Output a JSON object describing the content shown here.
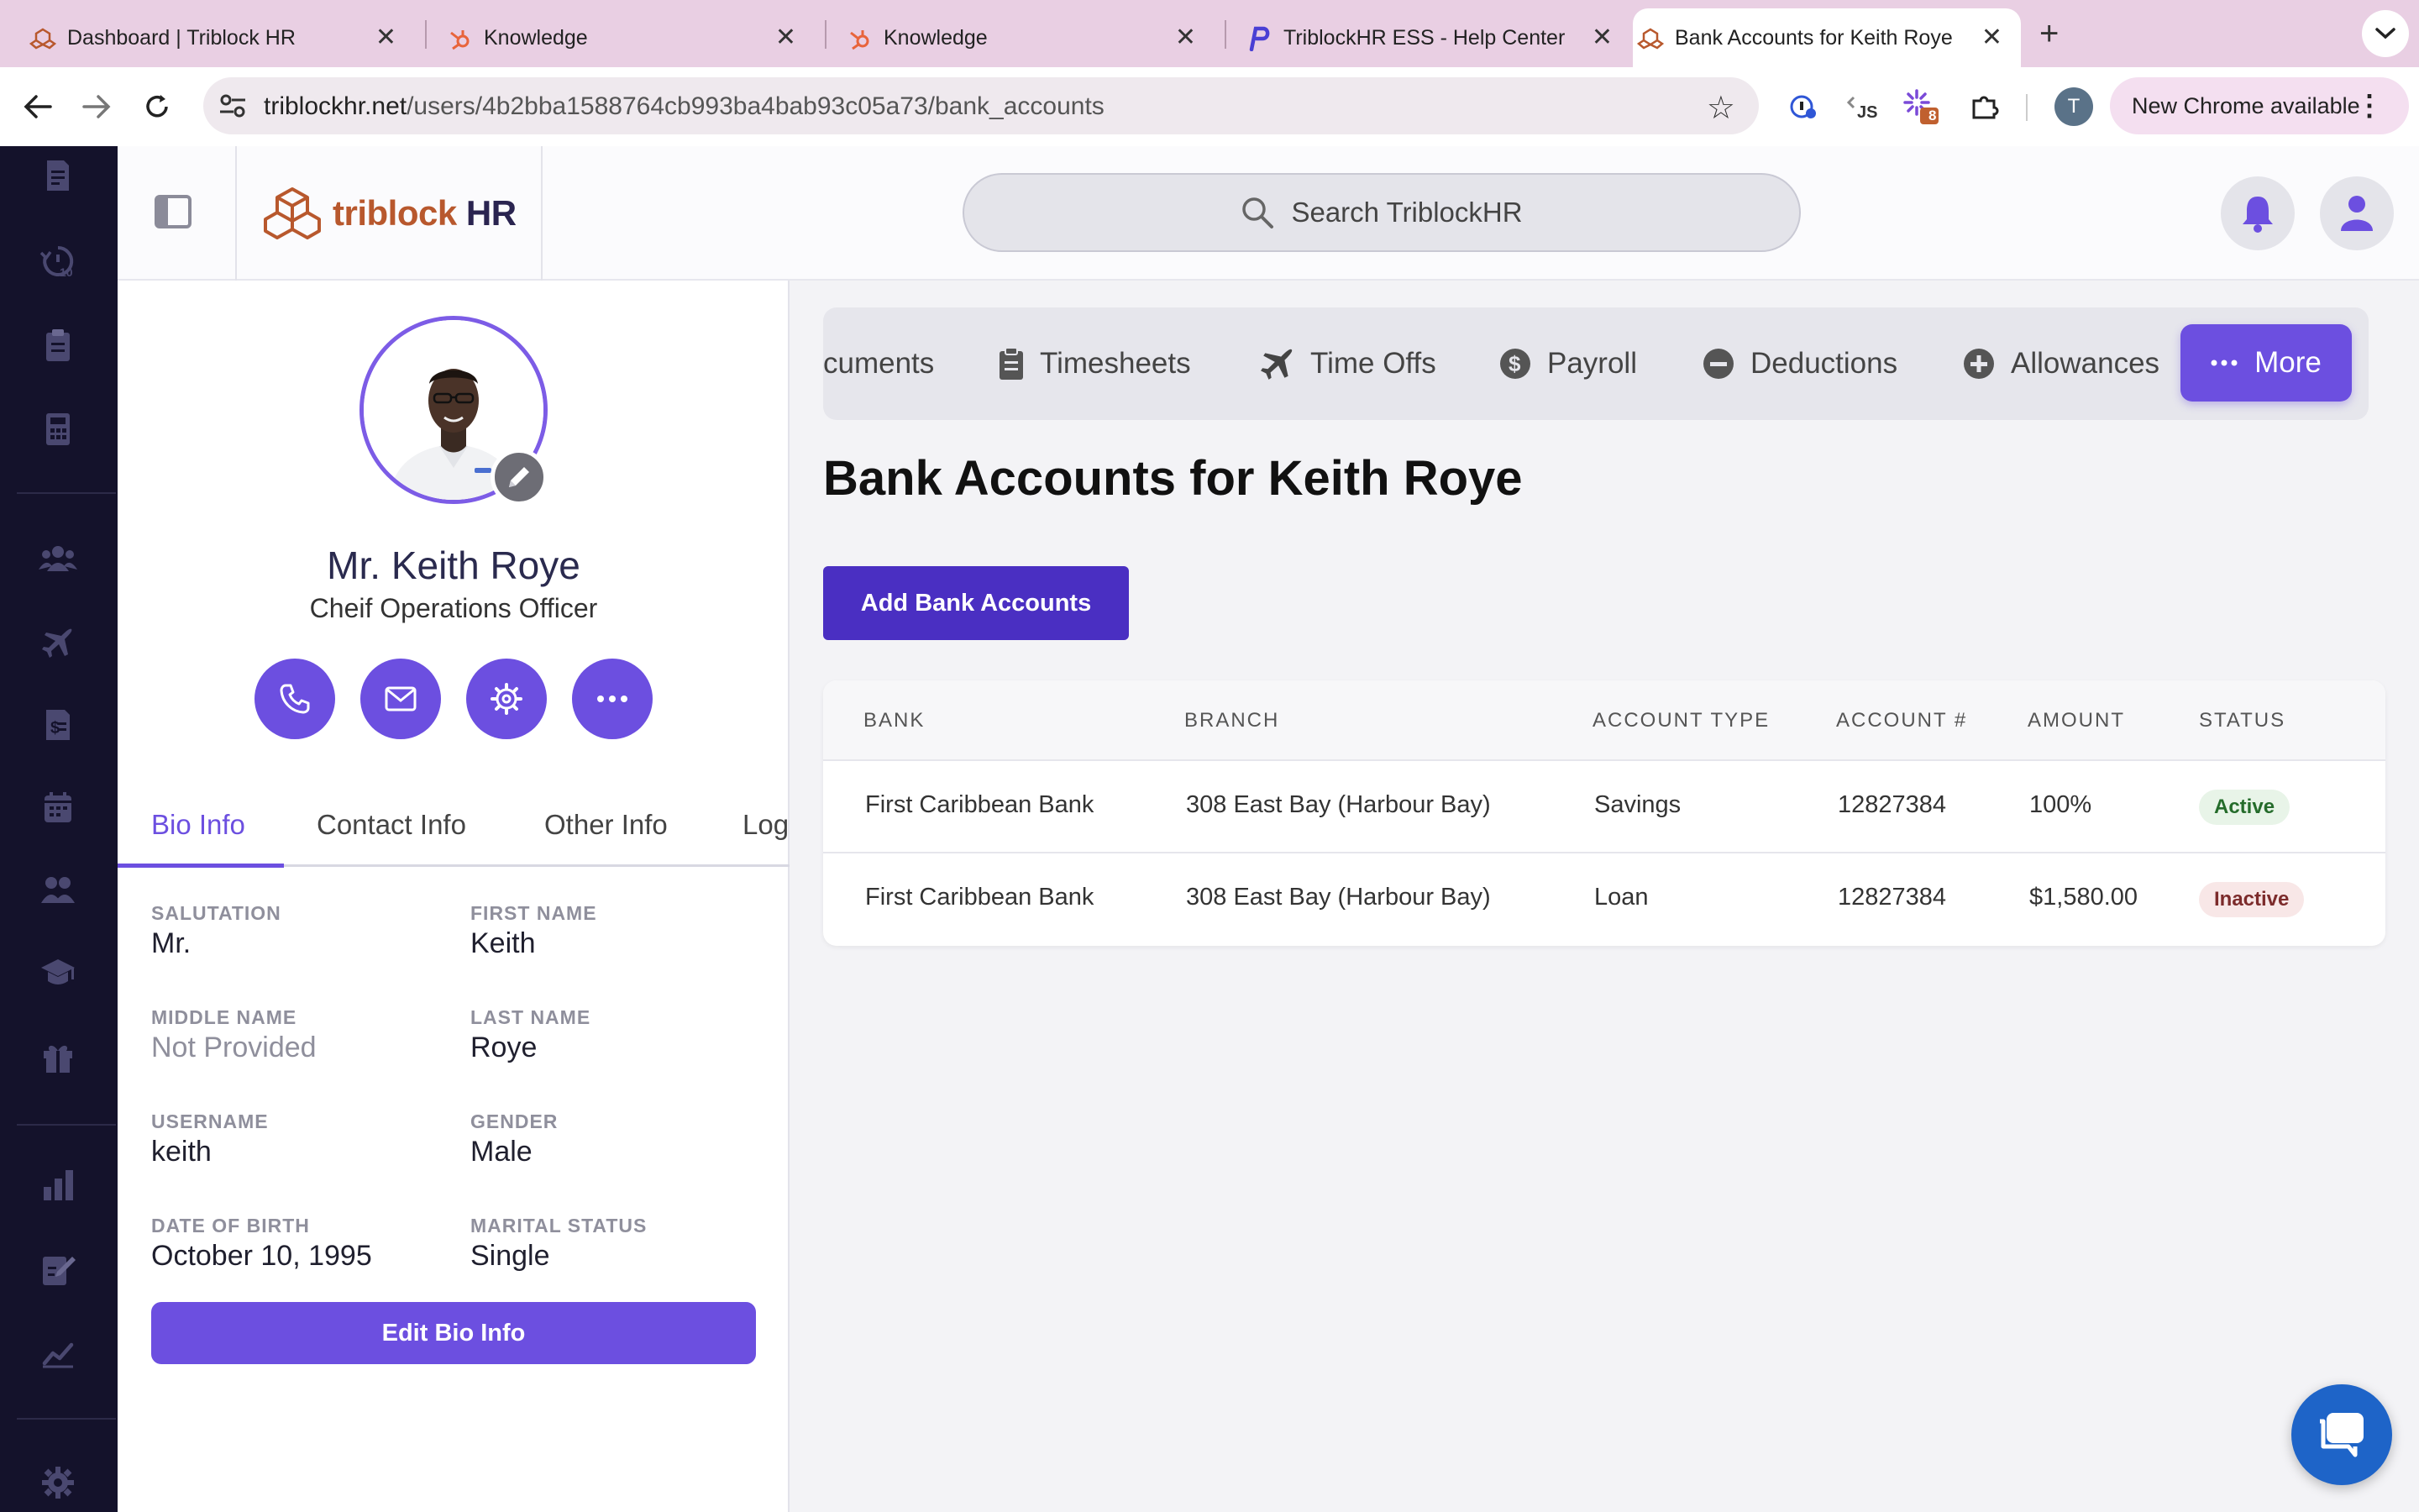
{
  "browser": {
    "tabs": [
      {
        "title": "Dashboard | Triblock HR"
      },
      {
        "title": "Knowledge"
      },
      {
        "title": "Knowledge"
      },
      {
        "title": "TriblockHR ESS - Help Center"
      },
      {
        "title": "Bank Accounts for Keith Roye"
      }
    ],
    "close_glyph": "✕",
    "new_tab_glyph": "+",
    "url_host": "triblockhr.net",
    "url_path": "/users/4b2bba1588764cb993ba4bab93c05a73/bank_accounts",
    "extension_badge": "8",
    "profile_initial": "T",
    "update_label": "New Chrome available"
  },
  "header": {
    "logo_word": "triblock",
    "logo_hr": "HR",
    "search_placeholder": "Search TriblockHR"
  },
  "profile": {
    "name": "Mr. Keith Roye",
    "job_title": "Cheif Operations Officer",
    "tabs": [
      "Bio Info",
      "Contact Info",
      "Other Info",
      "Log"
    ],
    "fields": [
      {
        "label": "SALUTATION",
        "value": "Mr."
      },
      {
        "label": "FIRST NAME",
        "value": "Keith"
      },
      {
        "label": "MIDDLE NAME",
        "value": "Not Provided"
      },
      {
        "label": "LAST NAME",
        "value": "Roye"
      },
      {
        "label": "USERNAME",
        "value": "keith"
      },
      {
        "label": "GENDER",
        "value": "Male"
      },
      {
        "label": "DATE OF BIRTH",
        "value": "October 10, 1995"
      },
      {
        "label": "MARITAL STATUS",
        "value": "Single"
      }
    ],
    "edit_button": "Edit Bio Info"
  },
  "subnav": {
    "items": [
      "cuments",
      "Timesheets",
      "Time Offs",
      "Payroll",
      "Deductions",
      "Allowances"
    ],
    "more_label": "More"
  },
  "main": {
    "title": "Bank Accounts for Keith Roye",
    "add_button": "Add Bank Accounts",
    "columns": [
      "BANK",
      "BRANCH",
      "ACCOUNT TYPE",
      "ACCOUNT #",
      "AMOUNT",
      "STATUS"
    ],
    "rows": [
      {
        "bank": "First Caribbean Bank",
        "branch": "308 East Bay (Harbour Bay)",
        "type": "Savings",
        "account": "12827384",
        "amount": "100%",
        "status": "Active"
      },
      {
        "bank": "First Caribbean Bank",
        "branch": "308 East Bay (Harbour Bay)",
        "type": "Loan",
        "account": "12827384",
        "amount": "$1,580.00",
        "status": "Inactive"
      }
    ]
  },
  "colors": {
    "accent": "#6c4fe0",
    "accent_dark": "#4a2fc2",
    "rail": "#14122b",
    "tabbar": "#e9cfe3",
    "logo_orange": "#b8582d"
  },
  "icons": {
    "rail": [
      "document-icon",
      "clock-10-icon",
      "clipboard-icon",
      "calculator-icon",
      "users-icon",
      "plane-icon",
      "id-card-icon",
      "calendar-icon",
      "team-icon",
      "graduation-cap-icon",
      "gift-icon",
      "bar-chart-icon",
      "edit-form-icon",
      "line-chart-icon",
      "gear-icon"
    ]
  }
}
